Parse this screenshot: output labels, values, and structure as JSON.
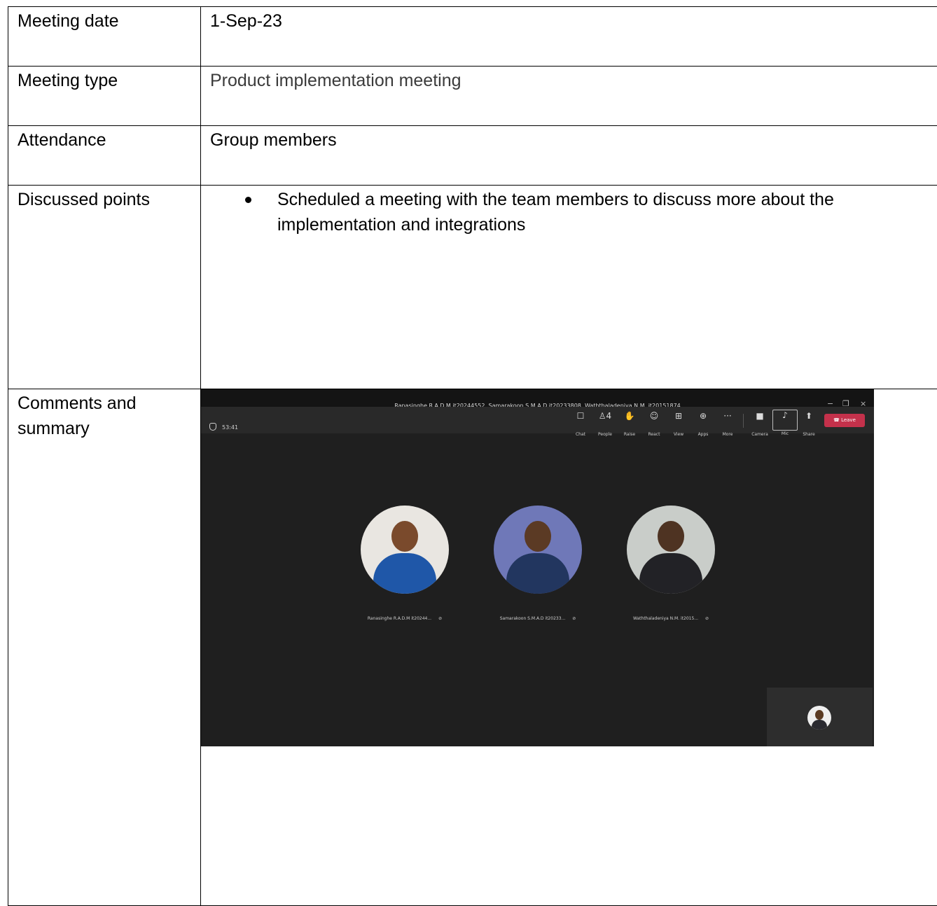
{
  "rows": {
    "date": {
      "label": "Meeting date",
      "value": "1-Sep-23"
    },
    "type": {
      "label": "Meeting type",
      "value": "Product implementation meeting"
    },
    "attendance": {
      "label": "Attendance",
      "value": "Group members"
    },
    "discussed": {
      "label": "Discussed points",
      "points": [
        "Scheduled a meeting with the team members to discuss more about the implementation and integrations"
      ]
    },
    "comments": {
      "label": "Comments and summary"
    }
  },
  "screenshot": {
    "title": "Ranasinghe R.A.D.M it20244552, Samarakoon S.M.A.D it20233808, Waththaladeniya N.M. it20151874",
    "timer": "53:41",
    "toolbar": [
      {
        "icon": "chat-icon",
        "glyph": "☐",
        "label": "Chat"
      },
      {
        "icon": "people-icon",
        "glyph": "♙4",
        "label": "People"
      },
      {
        "icon": "raise-hand-icon",
        "glyph": "✋",
        "label": "Raise"
      },
      {
        "icon": "react-icon",
        "glyph": "☺",
        "label": "React"
      },
      {
        "icon": "view-icon",
        "glyph": "⊞",
        "label": "View"
      },
      {
        "icon": "apps-icon",
        "glyph": "⊕",
        "label": "Apps"
      },
      {
        "icon": "more-icon",
        "glyph": "···",
        "label": "More"
      },
      {
        "icon": "camera-icon",
        "glyph": "■",
        "label": "Camera"
      },
      {
        "icon": "mic-icon",
        "glyph": "♪",
        "label": "Mic"
      },
      {
        "icon": "share-icon",
        "glyph": "⬆",
        "label": "Share"
      }
    ],
    "leave_label": "Leave",
    "participants": [
      {
        "name": "Ranasinghe R.A.D.M it20244...",
        "bg": "#e9e6e1",
        "shirt": "#1f57a8",
        "skin": "#7a4a2c"
      },
      {
        "name": "Samarakoon S.M.A.D it20233...",
        "bg": "#6f78b8",
        "shirt": "#22365f",
        "skin": "#5b3a24"
      },
      {
        "name": "Waththaladeniya N.M. it2015...",
        "bg": "#c9cdc9",
        "shirt": "#222226",
        "skin": "#4e3322"
      }
    ],
    "colors": {
      "window": "#1f1f1f",
      "toolbar": "#292929",
      "leave": "#c4314b"
    }
  }
}
